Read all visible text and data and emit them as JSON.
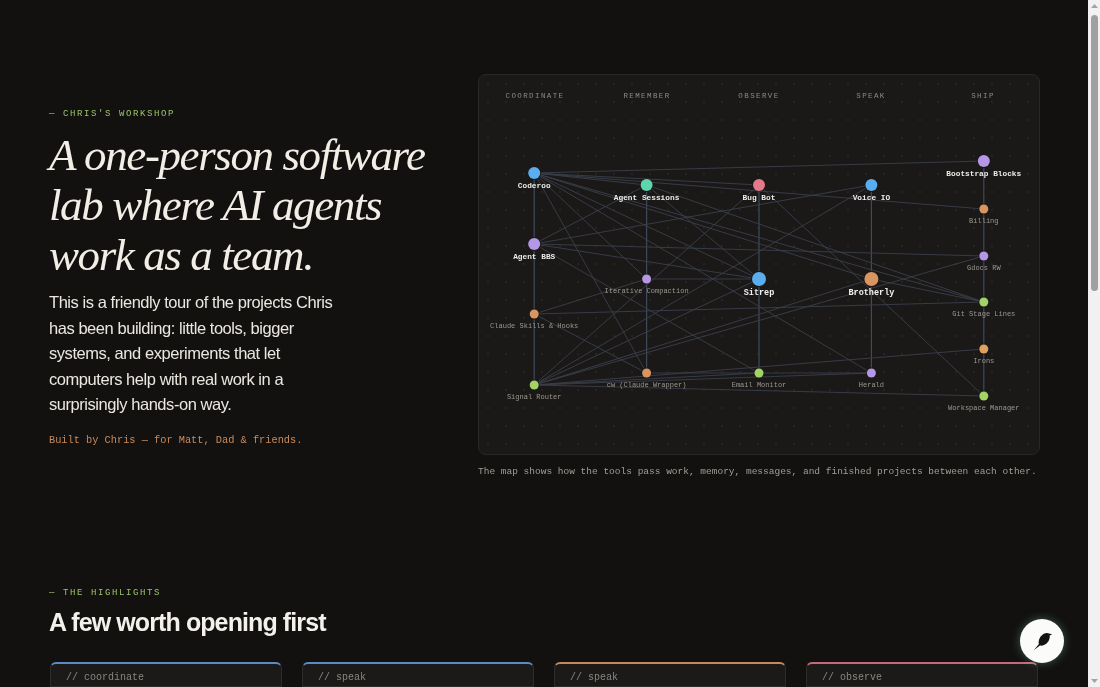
{
  "hero": {
    "eyebrow": "— CHRIS'S WORKSHOP",
    "headline": "A one-person software lab where AI agents work as a team.",
    "intro": "This is a friendly tour of the projects Chris has been building: little tools, bigger systems, and experiments that let computers help with real work in a surprisingly hands-on way.",
    "byline": "Built by Chris — for Matt, Dad & friends."
  },
  "map": {
    "columns": [
      {
        "label": "COORDINATE",
        "nodes": [
          {
            "label": "Coderoo",
            "kind": "primary",
            "color": "#5aaef0"
          },
          {
            "label": "Agent BBS",
            "kind": "primary",
            "color": "#b497e6"
          },
          {
            "label": "Claude Skills & Hooks",
            "kind": "secondary",
            "color": "#d9955f"
          },
          {
            "label": "Signal Router",
            "kind": "secondary",
            "color": "#a3d266"
          }
        ]
      },
      {
        "label": "REMEMBER",
        "nodes": [
          {
            "label": "Agent Sessions",
            "kind": "primary",
            "color": "#5fd4ad"
          },
          {
            "label": "Iterative Compaction",
            "kind": "secondary",
            "color": "#b497e6"
          },
          {
            "label": "cw (Claude Wrapper)",
            "kind": "secondary",
            "color": "#d9955f"
          }
        ]
      },
      {
        "label": "OBSERVE",
        "nodes": [
          {
            "label": "Bug Bot",
            "kind": "primary",
            "color": "#e5788a"
          },
          {
            "label": "Sitrep",
            "kind": "hub",
            "color": "#5aaef0"
          },
          {
            "label": "Email Monitor",
            "kind": "secondary",
            "color": "#a3d266"
          }
        ]
      },
      {
        "label": "SPEAK",
        "nodes": [
          {
            "label": "Voice IO",
            "kind": "primary",
            "color": "#5aaef0"
          },
          {
            "label": "Brotherly",
            "kind": "hub",
            "color": "#d9955f"
          },
          {
            "label": "Herald",
            "kind": "secondary",
            "color": "#b497e6"
          }
        ]
      },
      {
        "label": "SHIP",
        "nodes": [
          {
            "label": "Bootstrap Blocks",
            "kind": "primary",
            "color": "#b497e6"
          },
          {
            "label": "Billing",
            "kind": "secondary",
            "color": "#d9955f"
          },
          {
            "label": "Gdocs RW",
            "kind": "secondary",
            "color": "#b497e6"
          },
          {
            "label": "Git Stage Lines",
            "kind": "secondary",
            "color": "#a3d266"
          },
          {
            "label": "Irons",
            "kind": "secondary",
            "color": "#e0a060"
          },
          {
            "label": "Workspace Manager",
            "kind": "secondary",
            "color": "#a3d266"
          }
        ]
      }
    ],
    "caption": "The map shows how the tools pass work, memory, messages, and finished projects between each other."
  },
  "highlights": {
    "eyebrow": "— THE HIGHLIGHTS",
    "title": "A few worth opening first",
    "cards": [
      {
        "tag": "// coordinate",
        "color": "#5b8cc0"
      },
      {
        "tag": "// speak",
        "color": "#5b8cc0"
      },
      {
        "tag": "// speak",
        "color": "#c48a5c"
      },
      {
        "tag": "// observe",
        "color": "#c46a78"
      }
    ]
  }
}
